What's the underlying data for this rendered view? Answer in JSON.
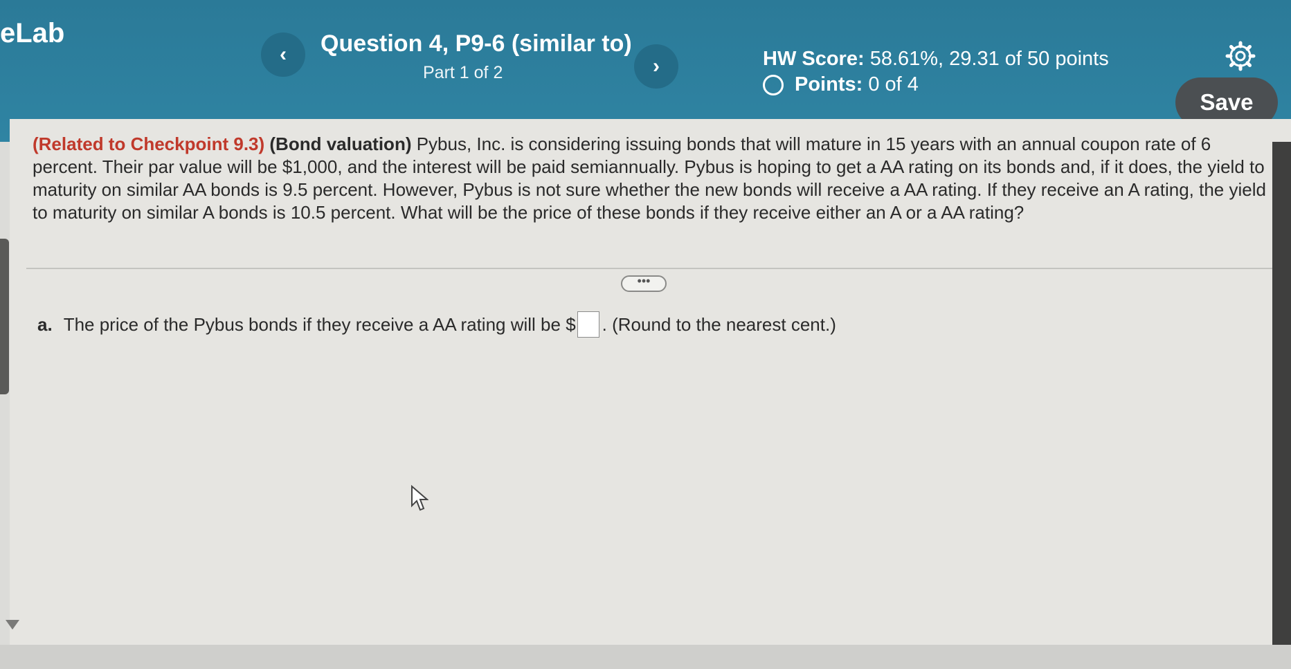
{
  "header": {
    "brand": "eLab",
    "prev_label": "‹",
    "next_label": "›",
    "question_title": "Question 4, P9-6 (similar to)",
    "question_part": "Part 1 of 2",
    "hw_score_label": "HW Score:",
    "hw_score_value": "58.61%, 29.31 of 50 points",
    "points_label": "Points:",
    "points_value": "0 of 4",
    "save_label": "Save",
    "gear_icon": "gear-icon"
  },
  "problem": {
    "related": "(Related to Checkpoint 9.3)",
    "topic": "(Bond valuation)",
    "text": "Pybus, Inc. is considering issuing bonds that will mature in 15 years with an annual coupon rate of 6 percent. Their par value will be $1,000, and the interest will be paid semiannually. Pybus is hoping to get a AA rating on its bonds and, if it does, the yield to maturity on similar AA bonds is 9.5 percent. However, Pybus is not sure whether the new bonds will receive a AA rating. If they receive an A rating, the yield to maturity on similar A bonds is 10.5 percent. What will be the price of these bonds if they receive either an A or a AA rating?"
  },
  "more_button": "•••",
  "part_a": {
    "label": "a.",
    "text_before": "The price of the Pybus bonds if they receive a AA rating will be $",
    "input_value": "",
    "text_after": ". (Round to the nearest cent.)"
  }
}
